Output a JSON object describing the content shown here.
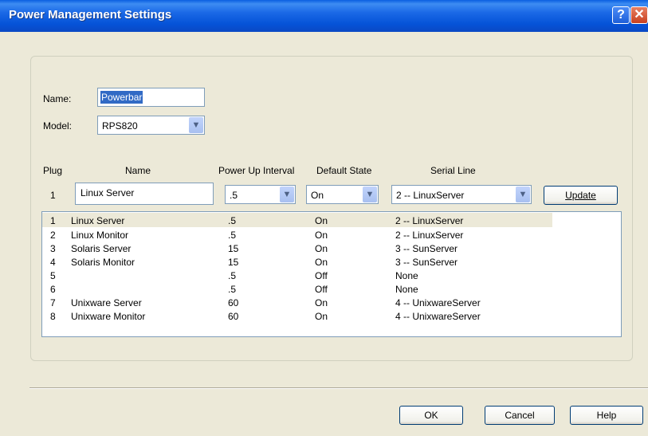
{
  "window": {
    "title": "Power Management Settings",
    "help_glyph": "?",
    "close_glyph": "✕"
  },
  "form": {
    "name_label": "Name:",
    "name_value": "Powerbar",
    "model_label": "Model:",
    "model_value": "RPS820"
  },
  "plug_table": {
    "headers": [
      "Plug",
      "Name",
      "Power Up Interval",
      "Default State",
      "Serial Line"
    ],
    "edit_row": {
      "plug": "1",
      "name": "Linux Server",
      "interval": ".5",
      "state": "On",
      "serial": "2 -- LinuxServer"
    },
    "update_label": "Update",
    "rows": [
      {
        "plug": "1",
        "name": "Linux Server",
        "interval": ".5",
        "state": "On",
        "serial": "2 -- LinuxServer"
      },
      {
        "plug": "2",
        "name": "Linux Monitor",
        "interval": ".5",
        "state": "On",
        "serial": "2 -- LinuxServer"
      },
      {
        "plug": "3",
        "name": "Solaris Server",
        "interval": "15",
        "state": "On",
        "serial": "3 -- SunServer"
      },
      {
        "plug": "4",
        "name": "Solaris Monitor",
        "interval": "15",
        "state": "On",
        "serial": "3 -- SunServer"
      },
      {
        "plug": "5",
        "name": "",
        "interval": ".5",
        "state": "Off",
        "serial": "None"
      },
      {
        "plug": "6",
        "name": "",
        "interval": ".5",
        "state": "Off",
        "serial": "None"
      },
      {
        "plug": "7",
        "name": "Unixware Server",
        "interval": "60",
        "state": "On",
        "serial": "4 -- UnixwareServer"
      },
      {
        "plug": "8",
        "name": "Unixware Monitor",
        "interval": "60",
        "state": "On",
        "serial": "4 -- UnixwareServer"
      }
    ]
  },
  "buttons": {
    "ok": "OK",
    "cancel": "Cancel",
    "help": "Help"
  },
  "icons": {
    "dropdown": "chevron-down-icon",
    "help": "help-icon",
    "close": "close-icon"
  },
  "colors": {
    "title_bar": "#0a5fe0",
    "selection": "#316ac5",
    "dialog_bg": "#ece9d8"
  }
}
